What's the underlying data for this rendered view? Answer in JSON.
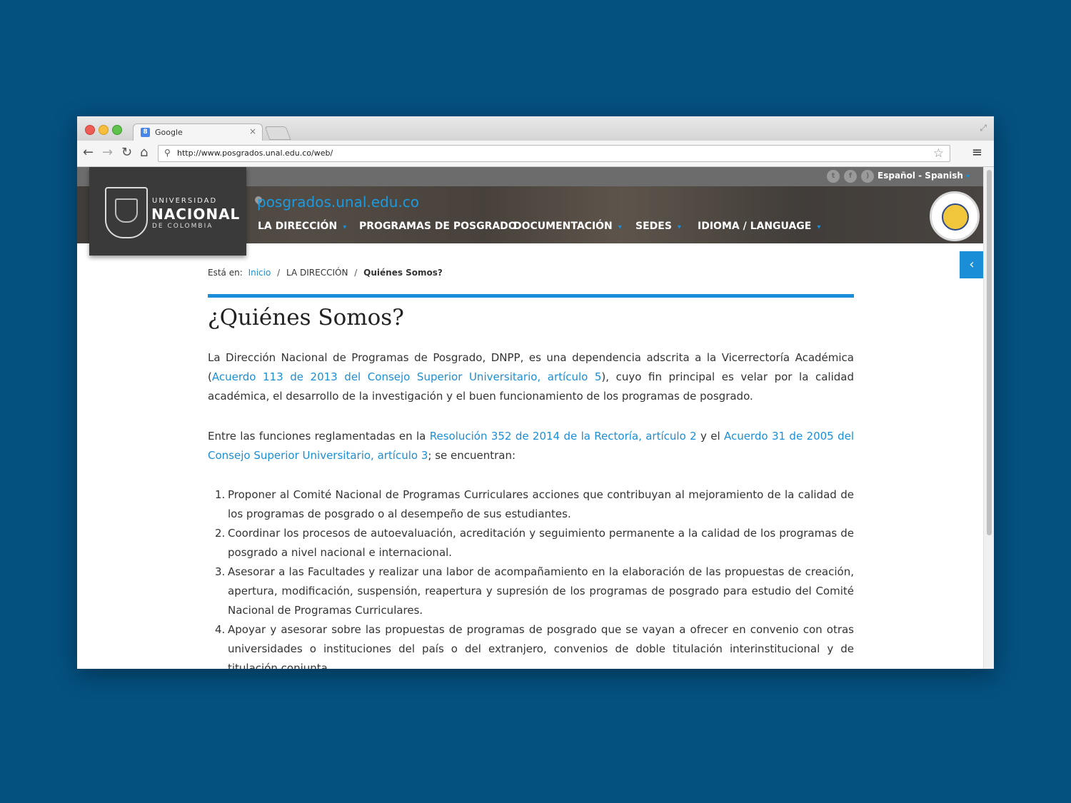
{
  "browser": {
    "tab_title": "Google",
    "tab_favicon": "8",
    "tab_close": "×",
    "url": "http://www.posgrados.unal.edu.co/web/",
    "icons": [
      "back-arrow-icon",
      "forward-arrow-icon",
      "reload-icon",
      "home-icon",
      "search-icon",
      "star-icon",
      "menu-icon"
    ]
  },
  "header": {
    "language": "Español - Spanish",
    "social": [
      "twitter",
      "facebook",
      "rss"
    ],
    "logo": {
      "line1": "UNIVERSIDAD",
      "line2": "NACIONAL",
      "line3": "DE COLOMBIA"
    },
    "site_name": "posgrados.unal.edu.co",
    "nav": [
      {
        "label": "LA DIRECCIÓN",
        "has_dropdown": true
      },
      {
        "label": "PROGRAMAS DE POSGRADO",
        "has_dropdown": false
      },
      {
        "label": "DOCUMENTACIÓN",
        "has_dropdown": true
      },
      {
        "label": "SEDES",
        "has_dropdown": true
      },
      {
        "label": "IDIOMA / LANGUAGE",
        "has_dropdown": true
      }
    ]
  },
  "breadcrumb": {
    "prefix": "Está en:",
    "home": "Inicio",
    "section": "LA DIRECCIÓN",
    "current": "Quiénes Somos?",
    "sep": "/"
  },
  "content": {
    "title": "¿Quiénes Somos?",
    "p1": {
      "before": "La Dirección Nacional de Programas de Posgrado, DNPP, es una dependencia adscrita a la Vicerrectoría Académica (",
      "link": "Acuerdo 113 de 2013 del Consejo Superior Universitario, artículo 5",
      "after": "), cuyo fin principal es velar por la calidad académica, el desarrollo de la investigación y el buen funcionamiento de los programas de posgrado."
    },
    "p2": {
      "before": "Entre las funciones reglamentadas en la ",
      "link1": "Resolución 352 de 2014 de la Rectoría, artículo 2",
      "middle": " y el ",
      "link2": "Acuerdo 31 de 2005 del Consejo Superior Universitario, artículo 3",
      "after": "; se encuentran:"
    },
    "functions": [
      {
        "num": "1.",
        "text": "Proponer al Comité Nacional de Programas Curriculares acciones que contribuyan al mejoramiento de la calidad de los programas de posgrado o al desempeño de sus estudiantes."
      },
      {
        "num": "2.",
        "text": "Coordinar los procesos de autoevaluación, acreditación y seguimiento permanente a la calidad de los programas de posgrado a nivel nacional e internacional."
      },
      {
        "num": "3.",
        "text": "Asesorar a las Facultades y realizar una labor de acompañamiento en la elaboración de las propuestas de creación, apertura, modificación, suspensión, reapertura y supresión de los programas de posgrado para estudio del Comité Nacional de Programas Curriculares."
      },
      {
        "num": "4.",
        "text": "Apoyar y asesorar sobre las propuestas de programas de posgrado que se vayan a ofrecer en convenio con otras universidades o instituciones del país o del extranjero, convenios de doble titulación interinstitucional y de titulación conjunta."
      }
    ]
  },
  "colors": {
    "background": "#04507f",
    "accent": "#1a8fd8",
    "header_dark": "#3a3a3a"
  }
}
